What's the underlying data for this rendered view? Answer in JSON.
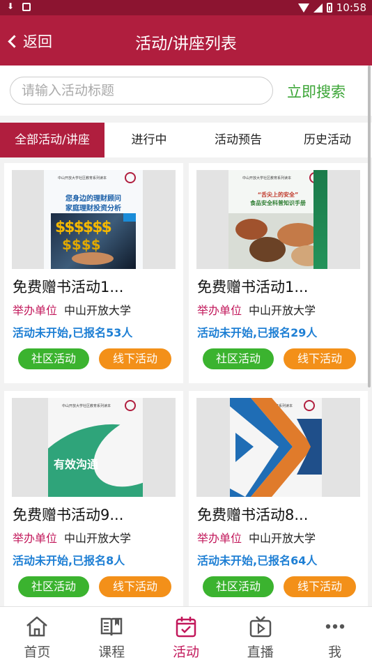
{
  "header": {
    "back_label": "返回",
    "title": "活动/讲座列表"
  },
  "search": {
    "placeholder": "请输入活动标题",
    "button_label": "立即搜索"
  },
  "tabs": [
    {
      "label": "全部活动/讲座",
      "active": true
    },
    {
      "label": "进行中",
      "active": false
    },
    {
      "label": "活动预告",
      "active": false
    },
    {
      "label": "历史活动",
      "active": false
    }
  ],
  "cards": [
    {
      "title": "免费赠书活动1...",
      "org_label": "举办单位",
      "org_value": "中山开放大学",
      "status": "活动未开始,已报名53人",
      "tags": [
        "社区活动",
        "线下活动"
      ],
      "cover_text": [
        "您身边的理财顾问",
        "家庭理财投资分析"
      ]
    },
    {
      "title": "免费赠书活动1...",
      "org_label": "举办单位",
      "org_value": "中山开放大学",
      "status": "活动未开始,已报名29人",
      "tags": [
        "社区活动",
        "线下活动"
      ],
      "cover_text": [
        "“舌尖上的安全”",
        "食品安全科普知识手册"
      ]
    },
    {
      "title": "免费赠书活动9...",
      "org_label": "举办单位",
      "org_value": "中山开放大学",
      "status": "活动未开始,已报名8人",
      "tags": [
        "社区活动",
        "线下活动"
      ],
      "cover_text": [
        "有效沟通"
      ]
    },
    {
      "title": "免费赠书活动8...",
      "org_label": "举办单位",
      "org_value": "中山开放大学",
      "status": "活动未开始,已报名64人",
      "tags": [
        "社区活动",
        "线下活动"
      ],
      "cover_text": []
    }
  ],
  "cover_series_text": "中山开放大学社区教育系列读本",
  "nav": [
    {
      "label": "首页",
      "icon": "home-icon",
      "active": false
    },
    {
      "label": "课程",
      "icon": "book-icon",
      "active": false
    },
    {
      "label": "活动",
      "icon": "calendar-check-icon",
      "active": true
    },
    {
      "label": "直播",
      "icon": "tv-play-icon",
      "active": false
    },
    {
      "label": "我",
      "icon": "more-icon",
      "active": false
    }
  ],
  "statusbar": {
    "time": "10:58"
  },
  "colors": {
    "brand": "#b01e3e",
    "accent_green": "#3bb32f",
    "accent_orange": "#f39019",
    "status_blue": "#1e7fd4",
    "label_pink": "#c2185b"
  }
}
